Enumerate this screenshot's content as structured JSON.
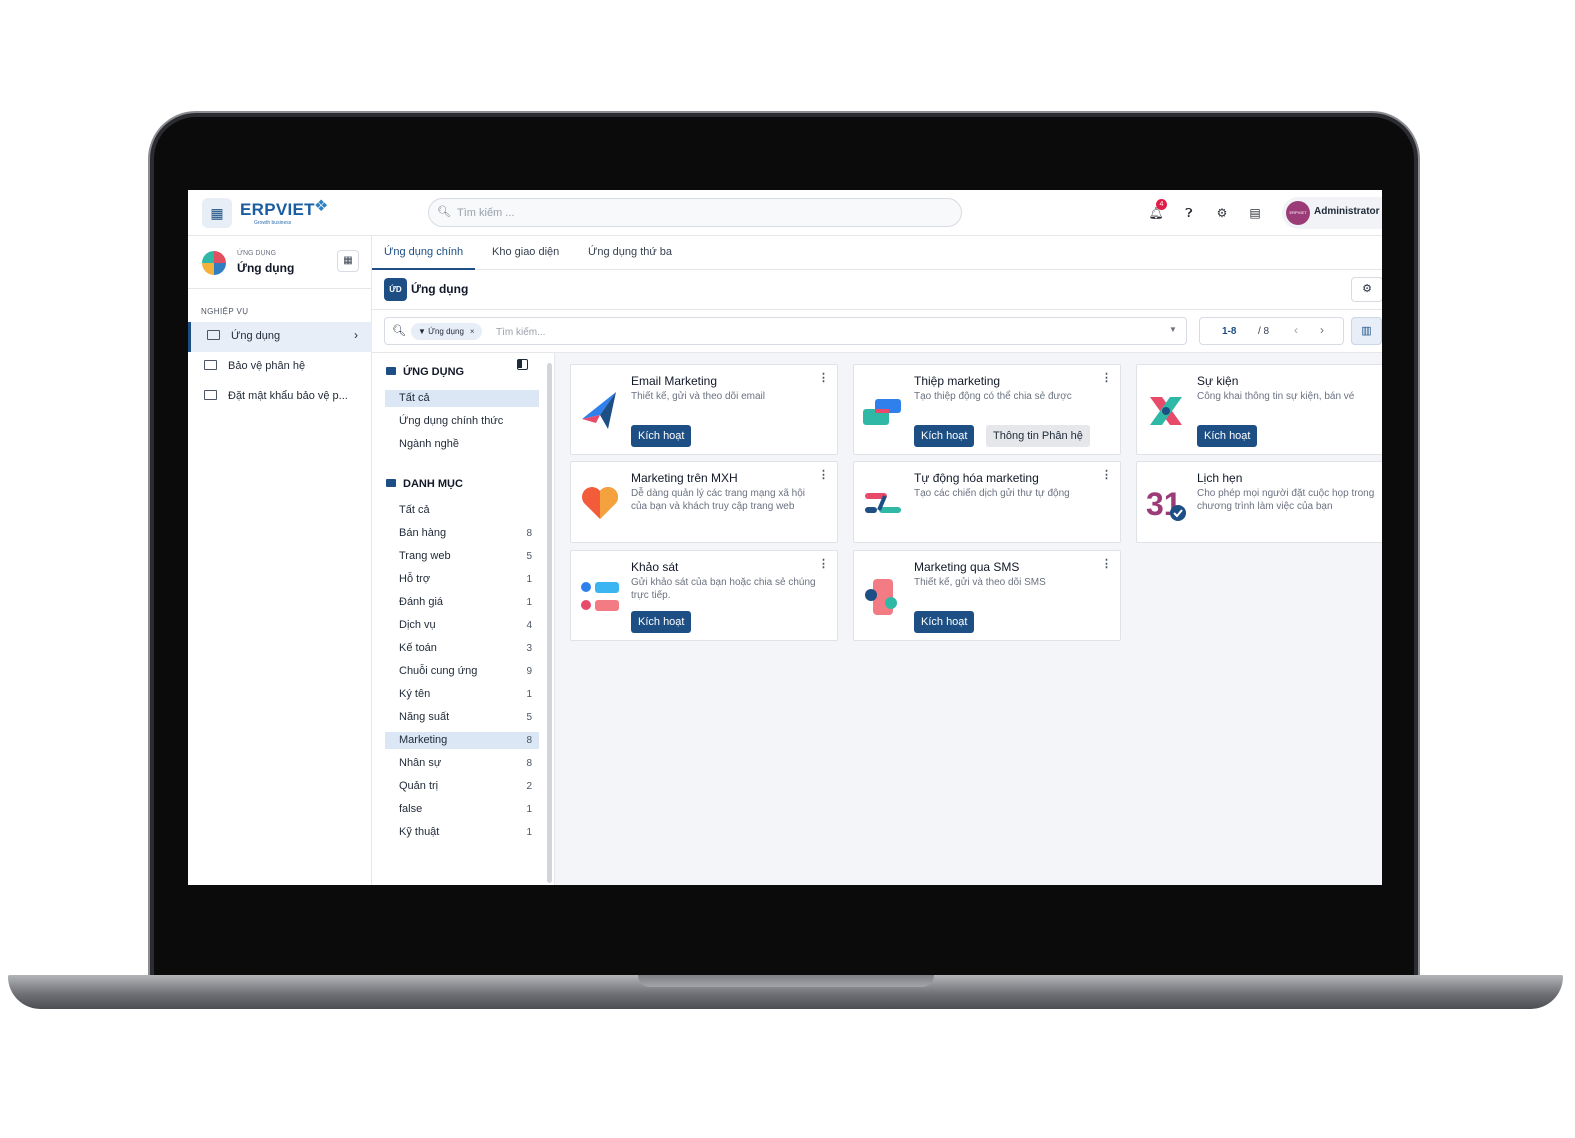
{
  "header": {
    "brand": "ERPVIET",
    "brand_tagline": "Growth business",
    "search_placeholder": "Tìm kiếm ...",
    "notification_count": "4",
    "user_name": "Administrator",
    "avatar_text": "ERPVIET"
  },
  "sidebar": {
    "module_small": "ỨNG DỤNG",
    "module_title": "Ứng dụng",
    "section": "NGHIỆP VỤ",
    "items": [
      {
        "label": "Ứng dụng"
      },
      {
        "label": "Bảo vệ phân hệ"
      },
      {
        "label": "Đặt mật khẩu bảo vệ p..."
      }
    ]
  },
  "tabs": [
    {
      "label": "Ứng dụng chính"
    },
    {
      "label": "Kho giao diện"
    },
    {
      "label": "Ứng dụng thứ ba"
    }
  ],
  "page": {
    "badge": "ỨD",
    "title": "Ứng dụng"
  },
  "filter": {
    "facet": "Ứng dụng",
    "placeholder": "Tìm kiếm...",
    "pager_value": "1-8",
    "pager_total": "/ 8"
  },
  "categories": {
    "group1_title": "ỨNG DỤNG",
    "group1": [
      {
        "label": "Tất cả"
      },
      {
        "label": "Ứng dụng chính thức"
      },
      {
        "label": "Ngành nghề"
      }
    ],
    "group2_title": "DANH MỤC",
    "group2": [
      {
        "label": "Tất cả",
        "count": ""
      },
      {
        "label": "Bán hàng",
        "count": "8"
      },
      {
        "label": "Trang web",
        "count": "5"
      },
      {
        "label": "Hỗ trợ",
        "count": "1"
      },
      {
        "label": "Đánh giá",
        "count": "1"
      },
      {
        "label": "Dịch vụ",
        "count": "4"
      },
      {
        "label": "Kế toán",
        "count": "3"
      },
      {
        "label": "Chuỗi cung ứng",
        "count": "9"
      },
      {
        "label": "Ký tên",
        "count": "1"
      },
      {
        "label": "Năng suất",
        "count": "5"
      },
      {
        "label": "Marketing",
        "count": "8"
      },
      {
        "label": "Nhân sự",
        "count": "8"
      },
      {
        "label": "Quản trị",
        "count": "2"
      },
      {
        "label": "false",
        "count": "1"
      },
      {
        "label": "Kỹ thuật",
        "count": "1"
      }
    ]
  },
  "apps": [
    {
      "title": "Email Marketing",
      "desc": "Thiết kế, gửi và theo dõi email",
      "button": "Kích hoạt"
    },
    {
      "title": "Thiệp marketing",
      "desc": "Tạo thiệp động có thể chia sẻ được",
      "button": "Kích hoạt",
      "button2": "Thông tin Phân hệ"
    },
    {
      "title": "Sự kiện",
      "desc": "Công khai thông tin sự kiện, bán vé",
      "button": "Kích hoạt"
    },
    {
      "title": "Marketing trên MXH",
      "desc": "Dễ dàng quản lý các trang mạng xã hội của bạn và khách truy cập trang web"
    },
    {
      "title": "Tự động hóa marketing",
      "desc": "Tạo các chiến dịch gửi thư tự động"
    },
    {
      "title": "Lịch hẹn",
      "desc": "Cho phép mọi người đặt cuộc họp trong chương trình làm việc của bạn",
      "icon_text": "31"
    },
    {
      "title": "Khảo sát",
      "desc": "Gửi khảo sát của bạn hoặc chia sẻ chúng trực tiếp.",
      "button": "Kích hoạt"
    },
    {
      "title": "Marketing qua SMS",
      "desc": "Thiết kế, gửi và theo dõi SMS",
      "button": "Kích hoạt"
    }
  ],
  "colors": {
    "primary": "#1d4f85",
    "active_bg": "#e7eef7"
  }
}
